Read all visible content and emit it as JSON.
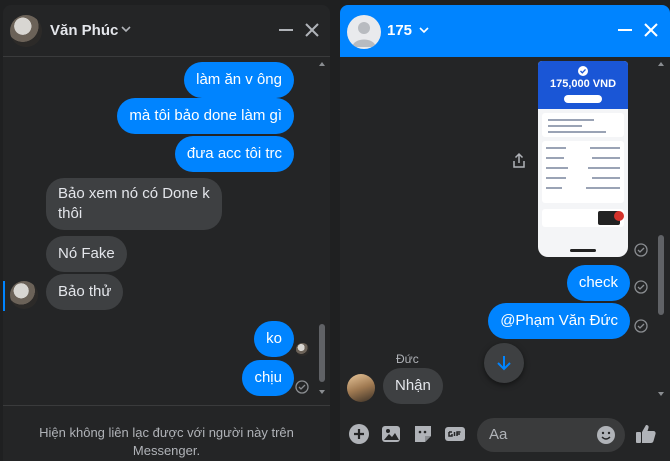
{
  "left_chat": {
    "contact_name": "Văn Phúc",
    "messages": [
      {
        "side": "out",
        "text": "làm ăn v ông"
      },
      {
        "side": "out",
        "text": "mà tôi bảo done làm gì"
      },
      {
        "side": "out",
        "text": "đưa acc tôi trc"
      },
      {
        "side": "in",
        "text_line1": "Bảo xem nó có Done k",
        "text_line2": "thôi"
      },
      {
        "side": "in",
        "text": "Nó Fake"
      },
      {
        "side": "in",
        "text": "Bảo thử"
      },
      {
        "side": "out",
        "text": "ko"
      },
      {
        "side": "out",
        "text": "chịu"
      }
    ],
    "footer_line1": "Hiện không liên lạc được với người này trên",
    "footer_line2": "Messenger."
  },
  "right_chat": {
    "contact_name": "175",
    "receipt": {
      "amount": "175,000 VND"
    },
    "messages": [
      {
        "side": "out",
        "text": "check"
      },
      {
        "side": "out",
        "text": "@Phạm Văn Đức"
      },
      {
        "side": "in",
        "sender": "Đức",
        "text": "Nhận"
      }
    ],
    "composer_placeholder": "Aa"
  },
  "colors": {
    "messenger_blue": "#0084ff",
    "panel_bg": "#242526",
    "incoming_bubble": "#3e4042",
    "text_primary": "#e4e6eb",
    "text_secondary": "#b0b3b8"
  },
  "icons": [
    "chevron-down-icon",
    "minimize-icon",
    "close-icon",
    "seen-check-icon",
    "share-icon",
    "scroll-down-arrow-icon",
    "plus-icon",
    "image-icon",
    "sticker-icon",
    "gif-icon",
    "emoji-icon",
    "like-thumb-icon"
  ]
}
